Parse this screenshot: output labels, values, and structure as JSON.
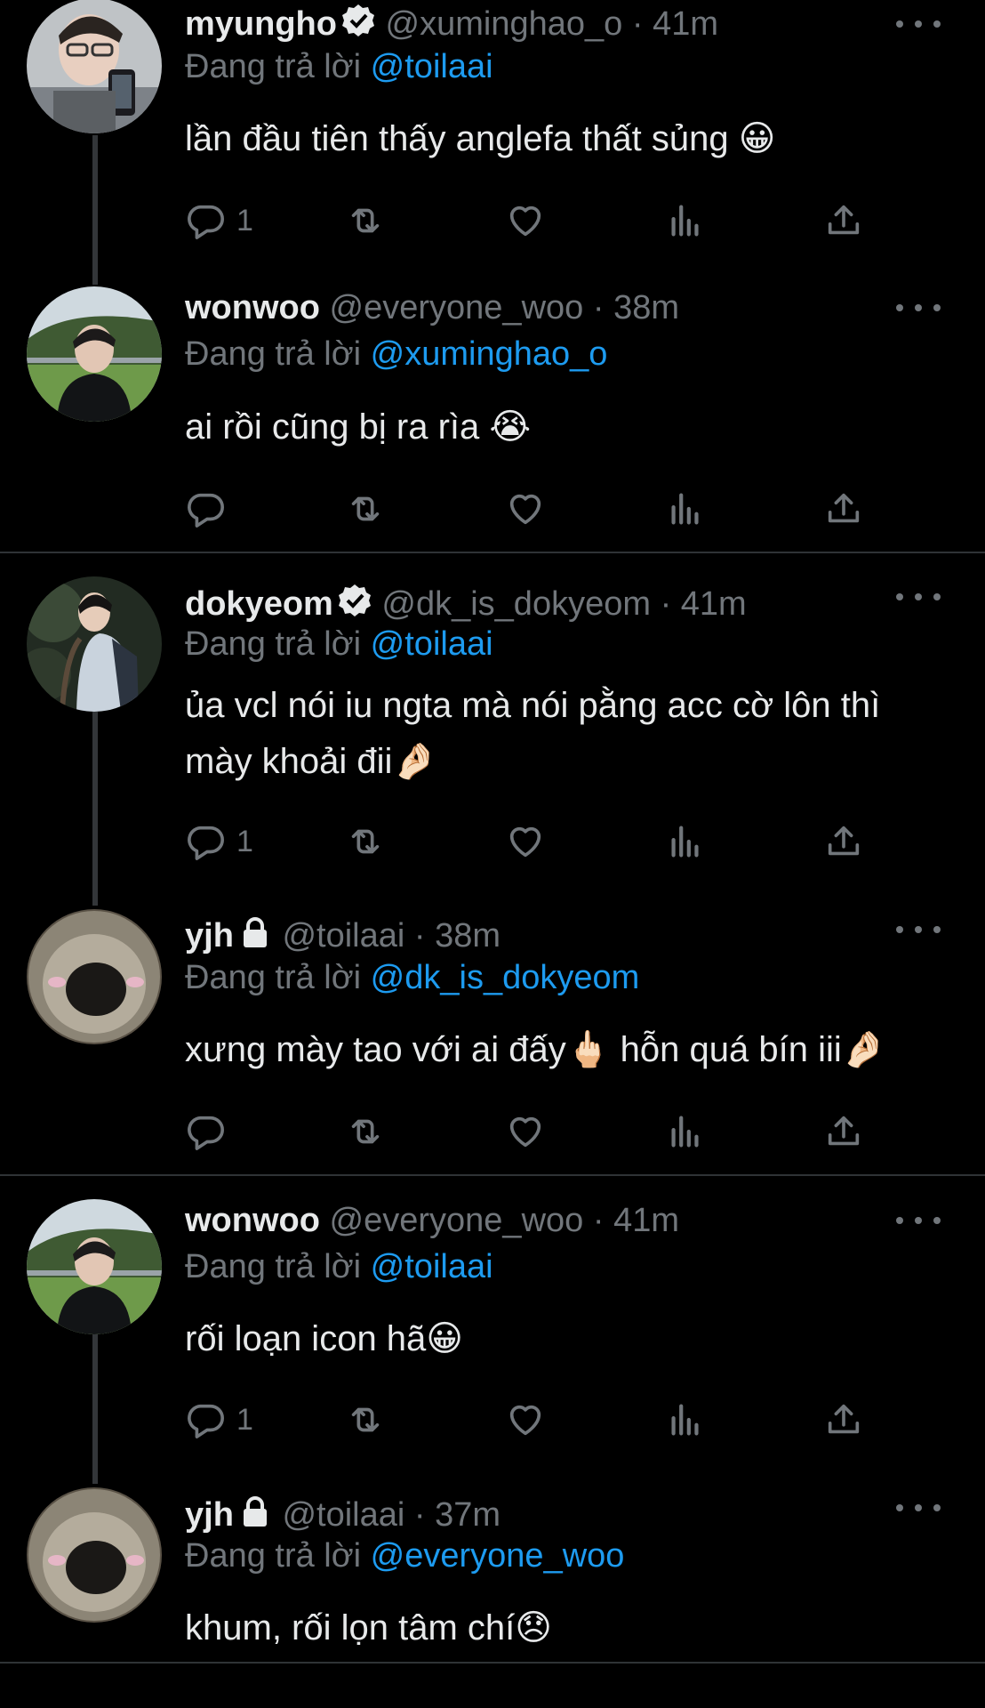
{
  "tweets": [
    {
      "name": "myungho",
      "verified": true,
      "locked": false,
      "handle": "@xuminghao_o",
      "time": "41m",
      "reply_prefix": "Đang trả lời",
      "reply_to": "@toilaai",
      "text": "lần đầu tiên thấy anglefa thất sủng 😀",
      "reply_count": "1",
      "avatar": "photo-selfie"
    },
    {
      "name": "wonwoo",
      "verified": false,
      "locked": false,
      "handle": "@everyone_woo",
      "time": "38m",
      "reply_prefix": "Đang trả lời",
      "reply_to": "@xuminghao_o",
      "text": "ai rồi cũng bị ra rìa 😭",
      "reply_count": "",
      "avatar": "photo-field"
    },
    {
      "name": "dokyeom",
      "verified": true,
      "locked": false,
      "handle": "@dk_is_dokyeom",
      "time": "41m",
      "reply_prefix": "Đang trả lời",
      "reply_to": "@toilaai",
      "text": "ủa vcl nói iu ngta mà nói pằng acc cờ lôn thì mày khoải đii🤌🏻",
      "reply_count": "1",
      "avatar": "photo-forest"
    },
    {
      "name": "yjh",
      "verified": false,
      "locked": true,
      "handle": "@toilaai",
      "time": "38m",
      "reply_prefix": "Đang trả lời",
      "reply_to": "@dk_is_dokyeom",
      "text": "xưng mày tao với ai đấy🖕🏻 hỗn quá bín iii🤌🏻",
      "reply_count": "",
      "avatar": "photo-seal"
    },
    {
      "name": "wonwoo",
      "verified": false,
      "locked": false,
      "handle": "@everyone_woo",
      "time": "41m",
      "reply_prefix": "Đang trả lời",
      "reply_to": "@toilaai",
      "text": "rối loạn icon hã😀",
      "reply_count": "1",
      "avatar": "photo-field"
    },
    {
      "name": "yjh",
      "verified": false,
      "locked": true,
      "handle": "@toilaai",
      "time": "37m",
      "reply_prefix": "Đang trả lời",
      "reply_to": "@everyone_woo",
      "text": "khum, rối lọn tâm chí😞",
      "reply_count": "",
      "avatar": "photo-seal"
    }
  ],
  "icons": {
    "reply": "reply-icon",
    "retweet": "retweet-icon",
    "like": "like-icon",
    "views": "views-icon",
    "share": "share-icon",
    "more": "more-icon",
    "verified": "verified-badge-icon",
    "locked": "lock-icon"
  },
  "colors": {
    "background": "#000000",
    "link": "#1d9bf0",
    "muted": "#71767b",
    "text": "#e7e9ea"
  }
}
